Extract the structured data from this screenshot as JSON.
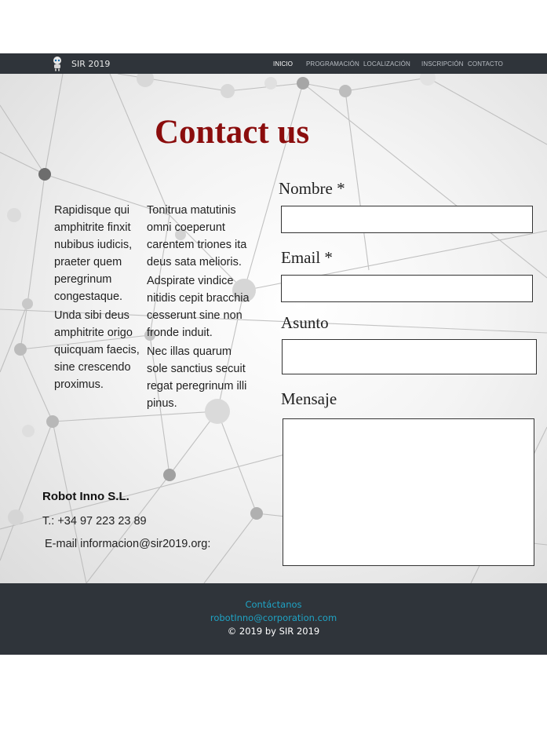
{
  "header": {
    "brand": "SIR 2019",
    "nav": [
      "INICIO",
      "PROGRAMACIÓN",
      "LOCALIZACIÓN",
      "INSCRIPCIÓN",
      "CONTACTO"
    ],
    "active": "INICIO",
    "logo_icon": "robot-logo-icon"
  },
  "page": {
    "title": "Contact us",
    "title_color": "#8b0d0d"
  },
  "text_columns": [
    [
      "Rapidisque qui amphitrite finxit nubibus iudicis, praeter quem peregrinum congestaque.",
      "Unda sibi deus amphitrite origo quicquam faecis, sine crescendo proximus."
    ],
    [
      "Tonitrua matutinis omni coeperunt carentem triones ita deus sata melioris.",
      "Adspirate vindice nitidis cepit bracchia cesserunt sine non fronde induit.",
      "Nec illas quarum sole sanctius secuit regat peregrinum illi pinus."
    ]
  ],
  "company": {
    "name": "Robot Inno S.L.",
    "phone": "T.: +34 97 223 23 89",
    "email": "E-mail informacion@sir2019.org:"
  },
  "form": {
    "nombre_label": "Nombre *",
    "nombre_value": "",
    "email_label": "Email *",
    "email_value": "",
    "asunto_label": "Asunto",
    "asunto_value": "",
    "mensaje_label": "Mensaje",
    "mensaje_value": ""
  },
  "footer": {
    "contact": "Contáctanos",
    "email": "robotInno@corporation.com",
    "copyright": "© 2019 by SIR 2019",
    "link_color": "#1fa3c4"
  }
}
